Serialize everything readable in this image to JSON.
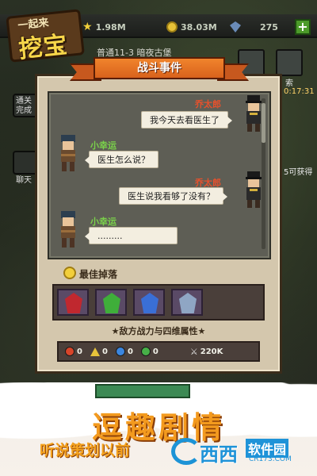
{
  "hud": {
    "logo_line1": "一起来",
    "logo_line2": "挖宝",
    "gold": "1.98M",
    "stones": "38.03M",
    "gems": "275",
    "stage": "普通11-3 暗夜古堡",
    "side_right_label": "索",
    "side_right_time": "0:17:31",
    "side_right_label2": "5可获得",
    "left_btn1": "通关",
    "left_btn2": "完成",
    "left_btn3": "聊天"
  },
  "event": {
    "title": "战斗事件",
    "messages": [
      {
        "speaker": "乔太郎",
        "side": "right",
        "text": "我今天去看医生了"
      },
      {
        "speaker": "小幸运",
        "side": "left",
        "text": "医生怎么说？"
      },
      {
        "speaker": "乔太郎",
        "side": "right",
        "text": "医生说我看够了没有？"
      },
      {
        "speaker": "小幸运",
        "side": "left",
        "text": "........."
      }
    ],
    "loot_title": "最佳掉落",
    "loot_items": [
      {
        "name": "red-gem",
        "color": "#c0282f"
      },
      {
        "name": "green-gem",
        "color": "#3fae3a"
      },
      {
        "name": "blue-gem",
        "color": "#3a6fd6"
      },
      {
        "name": "silver-gem",
        "color": "#8fa6c4"
      }
    ],
    "stats_title": "★敌方战力与四维属性★",
    "stats": [
      {
        "icon": "fire-icon",
        "color": "#d8452a",
        "value": "0"
      },
      {
        "icon": "earth-icon",
        "color": "#e6c33a",
        "value": "0"
      },
      {
        "icon": "water-icon",
        "color": "#3b86e0",
        "value": "0"
      },
      {
        "icon": "wind-icon",
        "color": "#47b048",
        "value": "0"
      }
    ],
    "power": "220K"
  },
  "promo": {
    "headline": "逗趣剧情",
    "subline": "听说策划以前",
    "watermark_brand": "西西",
    "watermark_tag": "软件园",
    "watermark_url": "CR173.COM"
  }
}
